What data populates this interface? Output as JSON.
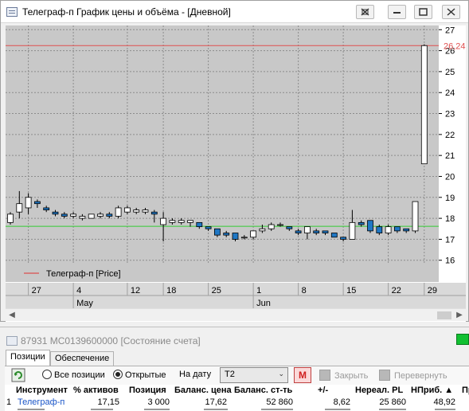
{
  "window": {
    "title": "Телеграф-п График цены и объёма - [Дневной]",
    "buttons": [
      "restore-icon",
      "minimize-icon",
      "maximize-icon",
      "close-icon"
    ]
  },
  "chart_data": {
    "type": "candlestick",
    "series_name": "Телеграф-п [Price]",
    "y_ticks": [
      16,
      17,
      18,
      19,
      20,
      21,
      22,
      23,
      24,
      25,
      26,
      27
    ],
    "ylim": [
      15.8,
      27.2
    ],
    "last_price_label": "26,24",
    "last_price": 26.24,
    "reference_line": 17.62,
    "x_day_ticks": [
      {
        "label": "27",
        "index": 2
      },
      {
        "label": "4",
        "index": 7
      },
      {
        "label": "12",
        "index": 13
      },
      {
        "label": "18",
        "index": 17
      },
      {
        "label": "25",
        "index": 22
      },
      {
        "label": "1",
        "index": 27
      },
      {
        "label": "8",
        "index": 32
      },
      {
        "label": "15",
        "index": 37
      },
      {
        "label": "22",
        "index": 42
      },
      {
        "label": "29",
        "index": 46
      }
    ],
    "x_month_ticks": [
      {
        "label": "May",
        "index": 7
      },
      {
        "label": "Jun",
        "index": 27
      }
    ],
    "candles": [
      {
        "o": 17.8,
        "h": 18.3,
        "l": 17.7,
        "c": 18.2
      },
      {
        "o": 18.3,
        "h": 19.3,
        "l": 18.0,
        "c": 18.7
      },
      {
        "o": 18.5,
        "h": 19.2,
        "l": 18.2,
        "c": 19.0
      },
      {
        "o": 18.8,
        "h": 18.9,
        "l": 18.5,
        "c": 18.7
      },
      {
        "o": 18.5,
        "h": 18.6,
        "l": 18.3,
        "c": 18.4
      },
      {
        "o": 18.3,
        "h": 18.4,
        "l": 18.1,
        "c": 18.2
      },
      {
        "o": 18.2,
        "h": 18.3,
        "l": 18.0,
        "c": 18.1
      },
      {
        "o": 18.1,
        "h": 18.3,
        "l": 18.0,
        "c": 18.2
      },
      {
        "o": 18.0,
        "h": 18.2,
        "l": 17.9,
        "c": 18.1
      },
      {
        "o": 18.0,
        "h": 18.2,
        "l": 18.0,
        "c": 18.2
      },
      {
        "o": 18.1,
        "h": 18.3,
        "l": 18.0,
        "c": 18.2
      },
      {
        "o": 18.2,
        "h": 18.3,
        "l": 18.0,
        "c": 18.1
      },
      {
        "o": 18.1,
        "h": 18.6,
        "l": 18.0,
        "c": 18.5
      },
      {
        "o": 18.3,
        "h": 18.6,
        "l": 18.2,
        "c": 18.5
      },
      {
        "o": 18.3,
        "h": 18.5,
        "l": 18.2,
        "c": 18.4
      },
      {
        "o": 18.3,
        "h": 18.5,
        "l": 18.2,
        "c": 18.4
      },
      {
        "o": 18.3,
        "h": 18.4,
        "l": 17.8,
        "c": 18.2
      },
      {
        "o": 17.7,
        "h": 18.3,
        "l": 16.9,
        "c": 18.0
      },
      {
        "o": 17.8,
        "h": 18.0,
        "l": 17.7,
        "c": 17.9
      },
      {
        "o": 17.8,
        "h": 18.0,
        "l": 17.7,
        "c": 17.9
      },
      {
        "o": 17.8,
        "h": 17.9,
        "l": 17.6,
        "c": 17.9
      },
      {
        "o": 17.8,
        "h": 17.8,
        "l": 17.5,
        "c": 17.6
      },
      {
        "o": 17.6,
        "h": 17.6,
        "l": 17.4,
        "c": 17.5
      },
      {
        "o": 17.5,
        "h": 17.5,
        "l": 17.1,
        "c": 17.2
      },
      {
        "o": 17.3,
        "h": 17.4,
        "l": 17.1,
        "c": 17.2
      },
      {
        "o": 17.3,
        "h": 17.3,
        "l": 16.9,
        "c": 17.0
      },
      {
        "o": 17.1,
        "h": 17.2,
        "l": 17.0,
        "c": 17.1
      },
      {
        "o": 17.1,
        "h": 17.4,
        "l": 17.0,
        "c": 17.4
      },
      {
        "o": 17.4,
        "h": 17.7,
        "l": 17.3,
        "c": 17.5
      },
      {
        "o": 17.5,
        "h": 17.8,
        "l": 17.4,
        "c": 17.7
      },
      {
        "o": 17.7,
        "h": 17.8,
        "l": 17.6,
        "c": 17.7
      },
      {
        "o": 17.6,
        "h": 17.6,
        "l": 17.4,
        "c": 17.5
      },
      {
        "o": 17.4,
        "h": 17.5,
        "l": 17.2,
        "c": 17.3
      },
      {
        "o": 17.3,
        "h": 17.6,
        "l": 17.0,
        "c": 17.6
      },
      {
        "o": 17.4,
        "h": 17.5,
        "l": 17.2,
        "c": 17.3
      },
      {
        "o": 17.4,
        "h": 17.4,
        "l": 17.2,
        "c": 17.3
      },
      {
        "o": 17.3,
        "h": 17.3,
        "l": 17.1,
        "c": 17.1
      },
      {
        "o": 17.1,
        "h": 17.1,
        "l": 16.9,
        "c": 17.0
      },
      {
        "o": 17.0,
        "h": 18.4,
        "l": 17.0,
        "c": 17.8
      },
      {
        "o": 17.8,
        "h": 17.9,
        "l": 17.6,
        "c": 17.7
      },
      {
        "o": 17.9,
        "h": 17.9,
        "l": 17.3,
        "c": 17.4
      },
      {
        "o": 17.6,
        "h": 17.7,
        "l": 17.2,
        "c": 17.3
      },
      {
        "o": 17.3,
        "h": 17.7,
        "l": 17.2,
        "c": 17.6
      },
      {
        "o": 17.6,
        "h": 17.6,
        "l": 17.3,
        "c": 17.4
      },
      {
        "o": 17.5,
        "h": 17.5,
        "l": 17.3,
        "c": 17.4
      },
      {
        "o": 17.4,
        "h": 18.8,
        "l": 17.3,
        "c": 18.8
      },
      {
        "o": 20.6,
        "h": 26.3,
        "l": 20.6,
        "c": 26.24
      }
    ],
    "colors": {
      "up": "#ffffff",
      "down": "#1f77c4",
      "price_line": "#e05050",
      "ref_line": "#33cc33"
    }
  },
  "panel": {
    "title": "87931 MC0139600000 [Состояние счета]",
    "tabs": [
      "Позиции",
      "Обеспечение"
    ],
    "toolbar": {
      "refresh_icon": "refresh-icon",
      "all_positions": "Все позиции",
      "open_positions": "Открытые",
      "date_label": "На дату",
      "date_value": "T2",
      "m_button": "M",
      "close_label": "Закрыть",
      "reverse_label": "Перевернуть"
    },
    "columns": [
      "Инструмент",
      "% активов",
      "Позиция",
      "Баланс. цена",
      "Баланс. ст-ть",
      "+/-",
      "Нереал. PL",
      "НПриб. ▲",
      "Пр"
    ],
    "rows": [
      {
        "num": "1",
        "instrument": "Телеграф-п",
        "pct": "17,15",
        "position": "3 000",
        "bal_price": "17,62",
        "bal_value": "52 860",
        "diff": "8,62",
        "unreal_pl": "25 860",
        "nprib": "48,92"
      }
    ]
  }
}
